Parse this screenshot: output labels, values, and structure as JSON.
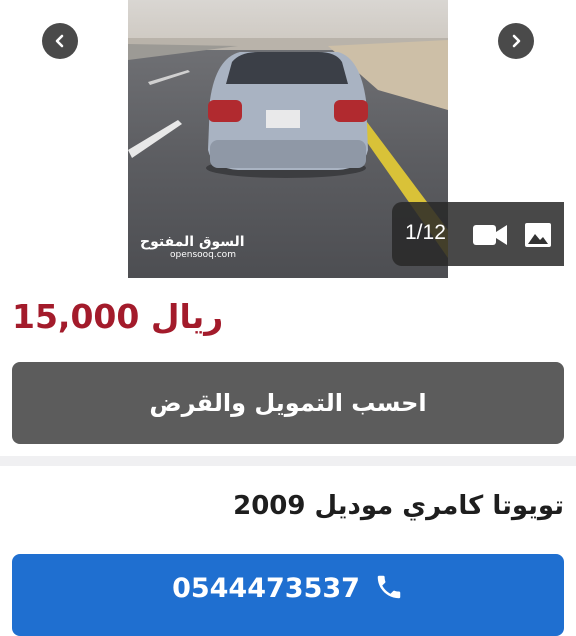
{
  "gallery": {
    "counter": "1/12",
    "watermark_ar": "السوق المفتوح",
    "watermark_en": "opensooq.com",
    "prev_icon": "chevron-left-icon",
    "next_icon": "chevron-right-icon",
    "video_icon": "video-camera-icon",
    "photo_icon": "image-icon"
  },
  "listing": {
    "price": "15,000 ريال",
    "finance_button": "احسب التمويل والقرض",
    "title": "تويوتا كامري موديل 2009",
    "phone": "0544473537",
    "phone_icon": "phone-icon"
  },
  "colors": {
    "price": "#a31b2b",
    "finance_button": "#5c5c5c",
    "call_button": "#1f6fd0"
  }
}
